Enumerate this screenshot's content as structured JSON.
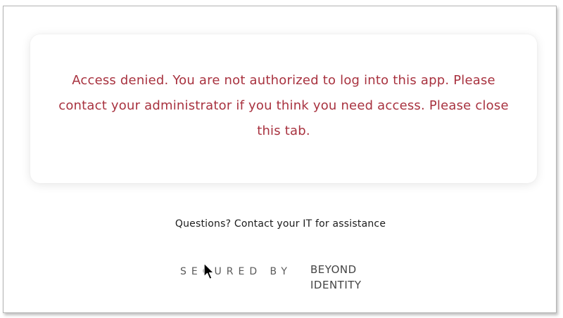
{
  "card": {
    "message": "Access denied. You are not authorized to log into this app. Please contact your administrator if you think you need access. Please close this tab."
  },
  "help": {
    "text": "Questions? Contact your IT for assistance"
  },
  "footer": {
    "secured_by": "SECURED BY",
    "brand_logo": "BEYOND IDENTITY"
  },
  "colors": {
    "error_text": "#a8323f",
    "frame_border": "#b4b4b4"
  },
  "icons": {
    "cursor": "mouse-pointer-icon"
  }
}
